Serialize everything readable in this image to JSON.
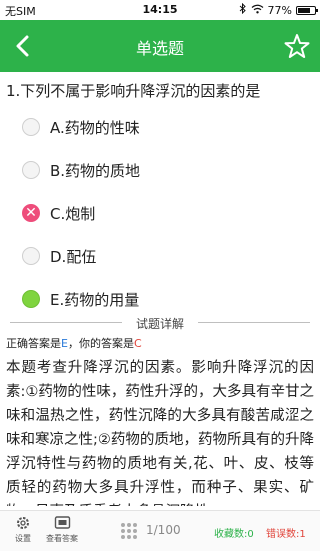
{
  "status_bar": {
    "carrier": "无SIM",
    "time": "14:15",
    "battery_percent": "77%",
    "battery_level": 0.77
  },
  "header": {
    "title": "单选题",
    "back_icon": "back-arrow-icon",
    "favorite_icon": "star-outline-icon",
    "color": "#2db24a"
  },
  "question": {
    "text": "1.下列不属于影响升降浮沉的因素的是",
    "options": [
      {
        "label": "A.药物的性味",
        "state": "none"
      },
      {
        "label": "B.药物的质地",
        "state": "none"
      },
      {
        "label": "C.炮制",
        "state": "wrong"
      },
      {
        "label": "D.配伍",
        "state": "none"
      },
      {
        "label": "E.药物的用量",
        "state": "correct"
      }
    ]
  },
  "detail": {
    "divider_label": "试题详解",
    "correct_prefix": "正确答案是",
    "correct_answer": "E",
    "your_prefix": "，你的答案是",
    "your_answer": "C",
    "explanation": "本题考查升降浮沉的因素。影响升降浮沉的因素:①药物的性味，药性升浮的，大多具有辛甘之味和温热之性，药性沉降的大多具有酸苦咸涩之味和寒凉之性;②药物的质地，药物所具有的升降浮沉特性与药物的质地有关,花、叶、皮、枝等质轻的药物大多具升浮性，而种子、果实、矿物、贝壳及质重者大多具沉降性。"
  },
  "bottom_bar": {
    "settings_label": "设置",
    "answer_label": "查看答案",
    "page": "1/100",
    "favorites": "收藏数:0",
    "errors": "错误数:1"
  },
  "colors": {
    "accent": "#2db24a",
    "wrong": "#ee4d7b",
    "correct": "#7fd43f",
    "correct_text": "#2a7ad8",
    "error_text": "#e0443a"
  }
}
